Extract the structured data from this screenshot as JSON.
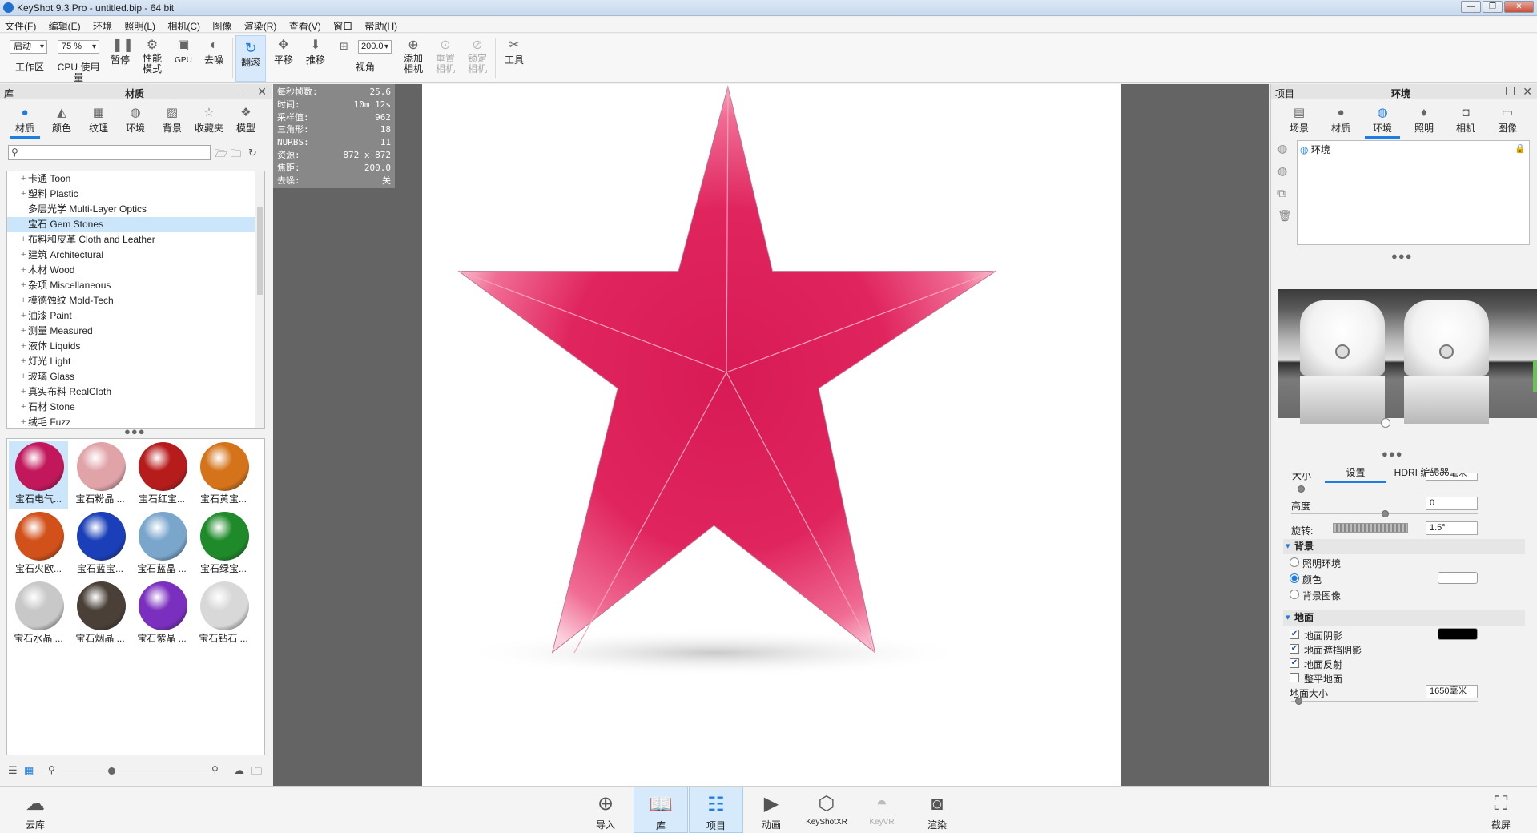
{
  "window": {
    "title": "KeyShot 9.3 Pro  - untitled.bip  - 64 bit"
  },
  "menu": [
    "文件(F)",
    "编辑(E)",
    "环境",
    "照明(L)",
    "相机(C)",
    "图像",
    "渲染(R)",
    "查看(V)",
    "窗口",
    "帮助(H)"
  ],
  "toolbar": {
    "workspace_select": "启动",
    "workspace_label": "工作区",
    "cpu_select": "75 %",
    "cpu_label": "CPU 使用量",
    "pause_label": "暂停",
    "perf_label": "性能\n模式",
    "gpu_label": "GPU",
    "denoise_label": "去噪",
    "tumble_label": "翻滚",
    "pan_label": "平移",
    "dolly_label": "推移",
    "fov_value": "200.0",
    "fov_label": "视角",
    "add_camera_label": "添加\n相机",
    "reset_camera_label": "重置\n相机",
    "lock_camera_label": "锁定\n相机",
    "tools_label": "工具"
  },
  "library": {
    "header_left": "库",
    "header_title": "材质",
    "tabs": [
      {
        "label": "材质",
        "icon": "material-icon"
      },
      {
        "label": "颜色",
        "icon": "color-icon"
      },
      {
        "label": "纹理",
        "icon": "texture-icon"
      },
      {
        "label": "环境",
        "icon": "environment-icon"
      },
      {
        "label": "背景",
        "icon": "background-icon"
      },
      {
        "label": "收藏夹",
        "icon": "favorites-icon"
      },
      {
        "label": "模型",
        "icon": "model-icon"
      }
    ],
    "search_placeholder": "",
    "tree": [
      {
        "label": "卡通 Toon",
        "expand": "+"
      },
      {
        "label": "塑料 Plastic",
        "expand": "+"
      },
      {
        "label": "多层光学 Multi-Layer Optics",
        "expand": ""
      },
      {
        "label": "宝石 Gem Stones",
        "expand": ""
      },
      {
        "label": "布料和皮革 Cloth and Leather",
        "expand": "+"
      },
      {
        "label": "建筑 Architectural",
        "expand": "+"
      },
      {
        "label": "木材 Wood",
        "expand": "+"
      },
      {
        "label": "杂项 Miscellaneous",
        "expand": "+"
      },
      {
        "label": "模德蚀纹 Mold-Tech",
        "expand": "+"
      },
      {
        "label": "油漆 Paint",
        "expand": "+"
      },
      {
        "label": "测量 Measured",
        "expand": "+"
      },
      {
        "label": "液体 Liquids",
        "expand": "+"
      },
      {
        "label": "灯光 Light",
        "expand": "+"
      },
      {
        "label": "玻璃 Glass",
        "expand": "+"
      },
      {
        "label": "真实布料 RealCloth",
        "expand": "+"
      },
      {
        "label": "石材 Stone",
        "expand": "+"
      },
      {
        "label": "绒毛 Fuzz",
        "expand": "+"
      }
    ],
    "selected_tree_item": "宝石 Gem Stones",
    "thumbnails": [
      {
        "label": "宝石电气...",
        "color": "#c2185b"
      },
      {
        "label": "宝石粉晶 ...",
        "color": "#e0a3a8"
      },
      {
        "label": "宝石红宝...",
        "color": "#b71c1c"
      },
      {
        "label": "宝石黄宝...",
        "color": "#d4731a"
      },
      {
        "label": "宝石火欧...",
        "color": "#d2501a"
      },
      {
        "label": "宝石蓝宝...",
        "color": "#1a3fb8"
      },
      {
        "label": "宝石蓝晶 ...",
        "color": "#7aa6cc"
      },
      {
        "label": "宝石绿宝...",
        "color": "#1f8a2a"
      },
      {
        "label": "宝石水晶 ...",
        "color": "#c8c8c8"
      },
      {
        "label": "宝石烟晶 ...",
        "color": "#4a4038"
      },
      {
        "label": "宝石紫晶 ...",
        "color": "#7b2fbf"
      },
      {
        "label": "宝石钻石 ...",
        "color": "#d8d8d8"
      }
    ]
  },
  "stats": [
    {
      "label": "每秒帧数:",
      "value": "25.6"
    },
    {
      "label": "时间:",
      "value": "10m 12s"
    },
    {
      "label": "采样值:",
      "value": "962"
    },
    {
      "label": "三角形:",
      "value": "18"
    },
    {
      "label": "NURBS:",
      "value": "11"
    },
    {
      "label": "资源:",
      "value": "872 x 872"
    },
    {
      "label": "焦距:",
      "value": "200.0"
    },
    {
      "label": "去噪:",
      "value": "关"
    }
  ],
  "project": {
    "header_left": "项目",
    "header_title": "环境",
    "tabs": [
      {
        "label": "场景",
        "icon": "scene-icon"
      },
      {
        "label": "材质",
        "icon": "material-icon"
      },
      {
        "label": "环境",
        "icon": "environment-icon"
      },
      {
        "label": "照明",
        "icon": "lighting-icon"
      },
      {
        "label": "相机",
        "icon": "camera-icon"
      },
      {
        "label": "图像",
        "icon": "image-icon"
      }
    ],
    "env_item": "环境",
    "subtabs": [
      "设置",
      "HDRI 编辑器"
    ],
    "size_label": "大小",
    "size_value": "5000毫米",
    "height_label": "高度",
    "height_value": "0",
    "rotation_label": "旋转:",
    "rotation_value": "1.5°",
    "background_section": "背景",
    "bg_options": [
      "照明环境",
      "颜色",
      "背景图像"
    ],
    "bg_selected": "颜色",
    "bg_color": "#ffffff",
    "ground_section": "地面",
    "ground_options": [
      {
        "label": "地面阴影",
        "checked": true
      },
      {
        "label": "地面遮挡阴影",
        "checked": true
      },
      {
        "label": "地面反射",
        "checked": true
      },
      {
        "label": "整平地面",
        "checked": false
      }
    ],
    "shadow_color": "#000000",
    "ground_size_label": "地面大小",
    "ground_size_value": "1650毫米"
  },
  "bottom": [
    {
      "label": "云库",
      "icon": "cloud-library-icon"
    },
    {
      "label": "导入",
      "icon": "import-icon"
    },
    {
      "label": "库",
      "icon": "library-icon"
    },
    {
      "label": "项目",
      "icon": "project-icon"
    },
    {
      "label": "动画",
      "icon": "animation-icon"
    },
    {
      "label": "KeyShotXR",
      "icon": "keyshotxr-icon"
    },
    {
      "label": "KeyVR",
      "icon": "keyvr-icon"
    },
    {
      "label": "渲染",
      "icon": "render-icon"
    },
    {
      "label": "截屏",
      "icon": "screenshot-icon"
    }
  ],
  "colors": {
    "accent": "#1f7de0",
    "star": "#e0245e"
  }
}
